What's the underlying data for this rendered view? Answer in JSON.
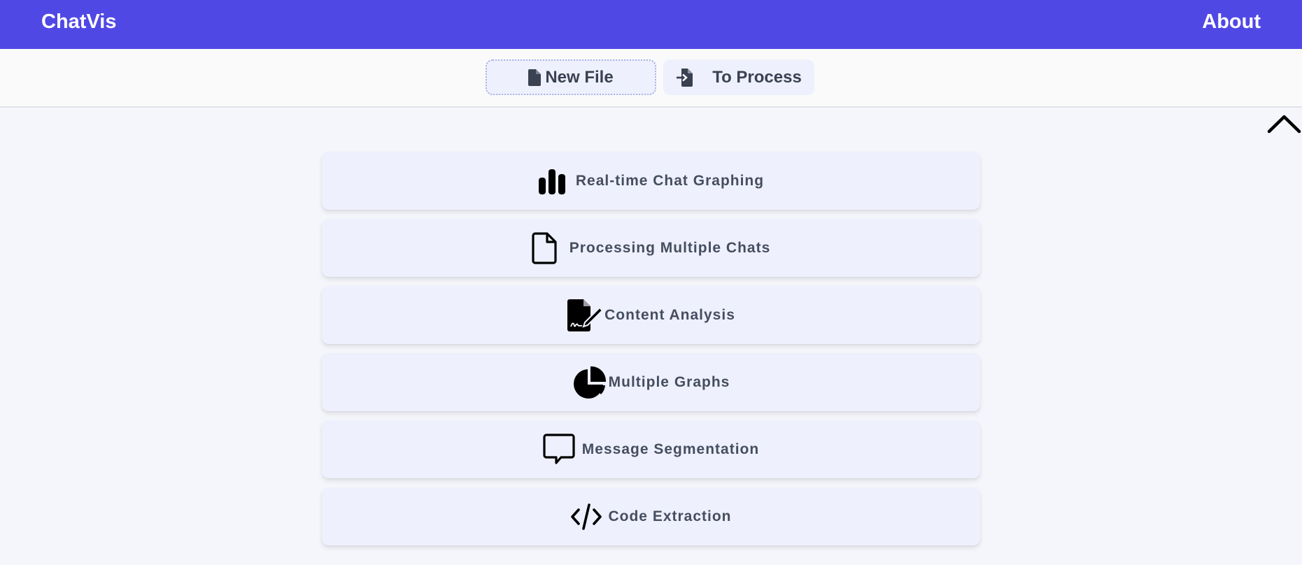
{
  "header": {
    "brand": "ChatVis",
    "about_label": "About"
  },
  "tabs": [
    {
      "label": "New File",
      "icon": "file-icon"
    },
    {
      "label": "To Process",
      "icon": "file-import-icon"
    }
  ],
  "features": [
    {
      "label": "Real-time Chat Graphing",
      "icon": "bar-chart-icon"
    },
    {
      "label": "Processing Multiple Chats",
      "icon": "document-icon"
    },
    {
      "label": "Content Analysis",
      "icon": "file-signature-icon"
    },
    {
      "label": "Multiple Graphs",
      "icon": "pie-chart-icon"
    },
    {
      "label": "Message Segmentation",
      "icon": "message-icon"
    },
    {
      "label": "Code Extraction",
      "icon": "code-icon"
    }
  ],
  "colors": {
    "header_bg": "#5048e5",
    "card_bg": "#eef0fd",
    "page_bg": "#f5f6fb",
    "text": "#454e5f"
  }
}
